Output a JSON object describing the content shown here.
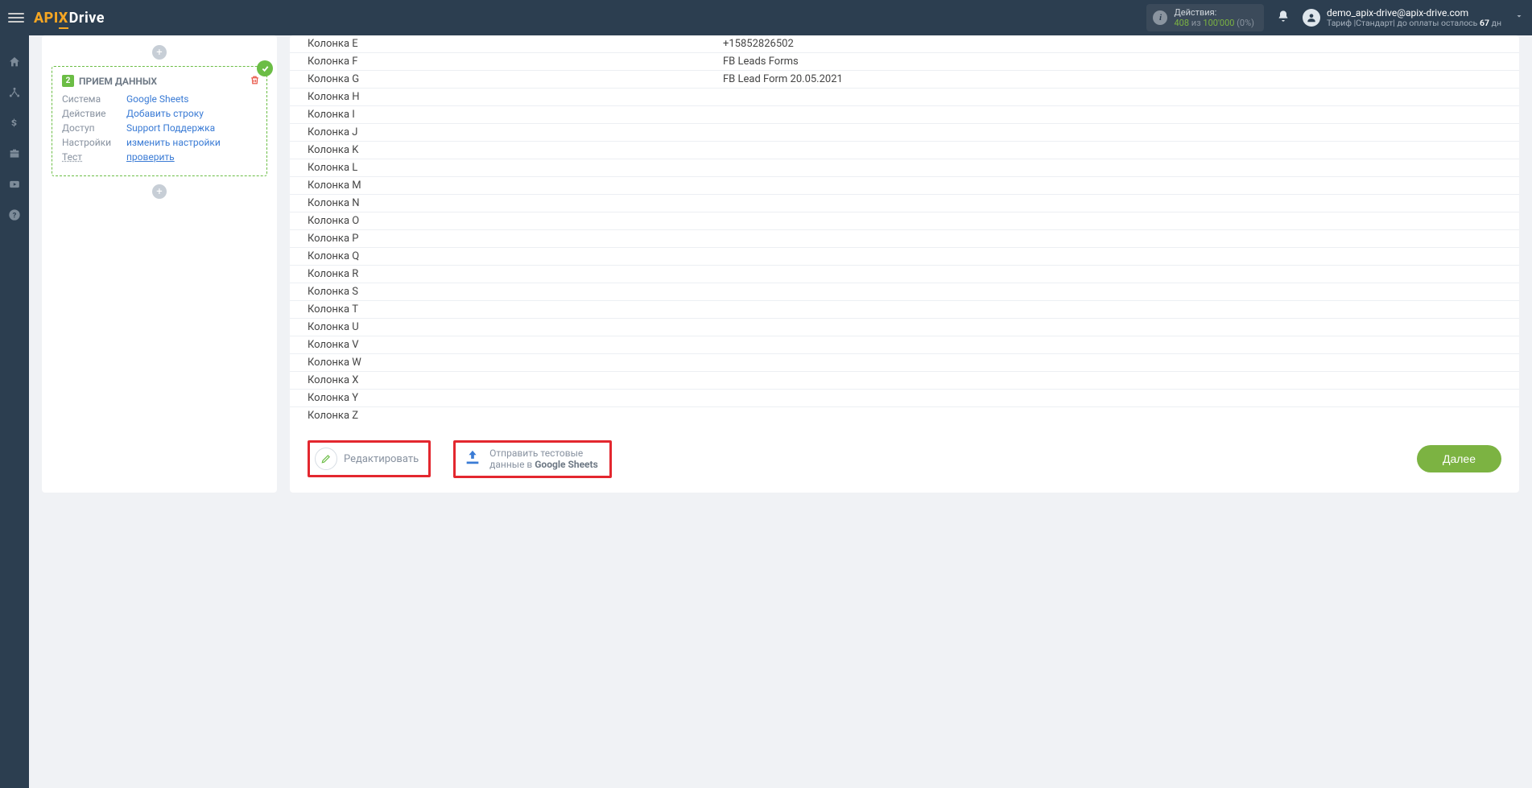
{
  "header": {
    "logo": {
      "left": "API",
      "mid": "X",
      "right": "Drive"
    },
    "actions": {
      "label": "Действия:",
      "used": "408",
      "sep": "из",
      "total": "100'000",
      "pct": "(0%)"
    },
    "user": {
      "email": "demo_apix-drive@apix-drive.com",
      "tariff_prefix": "Тариф |Стандарт| до оплаты осталось ",
      "days": "67",
      "days_suffix": " дн"
    }
  },
  "step": {
    "num": "2",
    "title": "ПРИЕМ ДАННЫХ",
    "rows": [
      {
        "label": "Система",
        "value": "Google Sheets",
        "label_underline": false,
        "val_underline": false
      },
      {
        "label": "Действие",
        "value": "Добавить строку",
        "label_underline": false,
        "val_underline": false
      },
      {
        "label": "Доступ",
        "value": "Support Поддержка",
        "label_underline": false,
        "val_underline": false
      },
      {
        "label": "Настройки",
        "value": "изменить настройки",
        "label_underline": false,
        "val_underline": false
      },
      {
        "label": "Тест",
        "value": "проверить",
        "label_underline": true,
        "val_underline": true
      }
    ]
  },
  "columns": [
    {
      "name": "Колонка E",
      "value": "+15852826502"
    },
    {
      "name": "Колонка F",
      "value": "FB Leads Forms"
    },
    {
      "name": "Колонка G",
      "value": "FB Lead Form 20.05.2021"
    },
    {
      "name": "Колонка H",
      "value": ""
    },
    {
      "name": "Колонка I",
      "value": ""
    },
    {
      "name": "Колонка J",
      "value": ""
    },
    {
      "name": "Колонка K",
      "value": ""
    },
    {
      "name": "Колонка L",
      "value": ""
    },
    {
      "name": "Колонка M",
      "value": ""
    },
    {
      "name": "Колонка N",
      "value": ""
    },
    {
      "name": "Колонка O",
      "value": ""
    },
    {
      "name": "Колонка P",
      "value": ""
    },
    {
      "name": "Колонка Q",
      "value": ""
    },
    {
      "name": "Колонка R",
      "value": ""
    },
    {
      "name": "Колонка S",
      "value": ""
    },
    {
      "name": "Колонка T",
      "value": ""
    },
    {
      "name": "Колонка U",
      "value": ""
    },
    {
      "name": "Колонка V",
      "value": ""
    },
    {
      "name": "Колонка W",
      "value": ""
    },
    {
      "name": "Колонка X",
      "value": ""
    },
    {
      "name": "Колонка Y",
      "value": ""
    },
    {
      "name": "Колонка Z",
      "value": ""
    }
  ],
  "footer": {
    "edit": "Редактировать",
    "send_line1": "Отправить тестовые",
    "send_line2_a": "данные в ",
    "send_line2_b": "Google Sheets",
    "next": "Далее"
  }
}
